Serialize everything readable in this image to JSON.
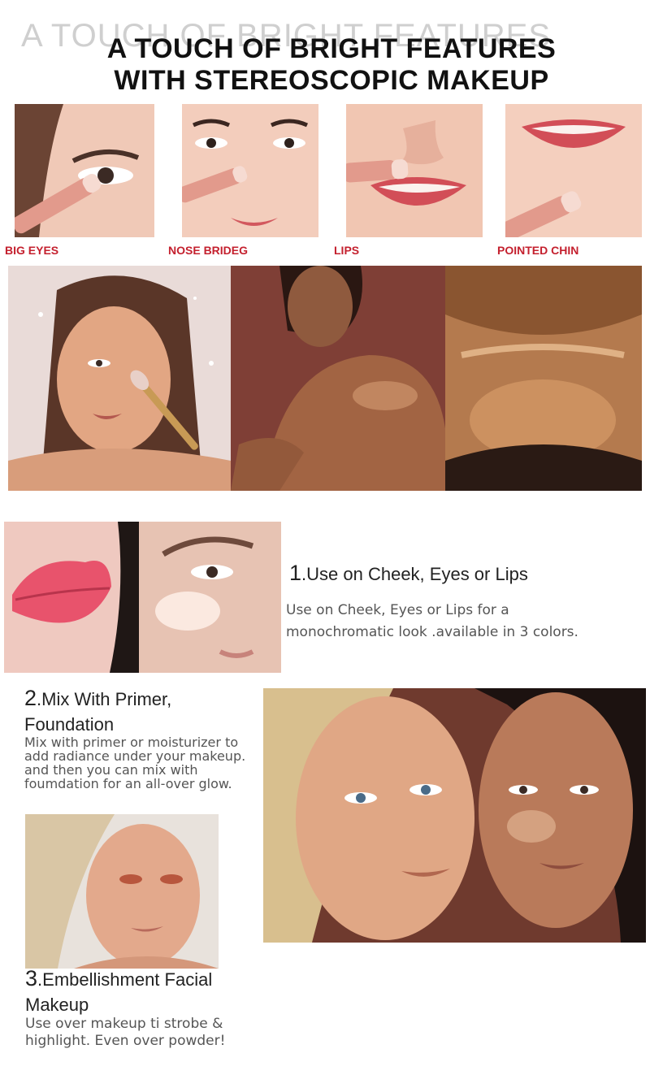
{
  "header": {
    "watermark": "A TOUCH OF BRIGHT FEATURES",
    "title_line1": "A TOUCH OF BRIGHT FEATURES",
    "title_line2": "WITH STEREOSCOPIC MAKEUP"
  },
  "features": [
    {
      "label": "BIG EYES"
    },
    {
      "label": "NOSE BRIDEG"
    },
    {
      "label": "LIPS"
    },
    {
      "label": "POINTED CHIN"
    }
  ],
  "steps": [
    {
      "number": "1",
      "title": ".Use on Cheek, Eyes or Lips",
      "description": "Use on Cheek, Eyes or Lips for a monochromatic look .available in 3 colors."
    },
    {
      "number": "2",
      "title_line1": ".Mix With Primer,",
      "title_line2": "Foundation",
      "description": "Mix with primer or moisturizer to add radiance under your makeup. and then you can mix with foumdation for an all-over glow."
    },
    {
      "number": "3",
      "title_line1": ".Embellishment Facial",
      "title_line2": "Makeup",
      "description": "Use over makeup ti strobe & highlight. Even over powder!"
    }
  ],
  "colors": {
    "label_red": "#c4202e",
    "skin_light": "#f1c7b3",
    "skin_tan": "#c68560",
    "skin_deep": "#8a5236",
    "stick_pink": "#e79a8e",
    "lip_red": "#d95258"
  }
}
